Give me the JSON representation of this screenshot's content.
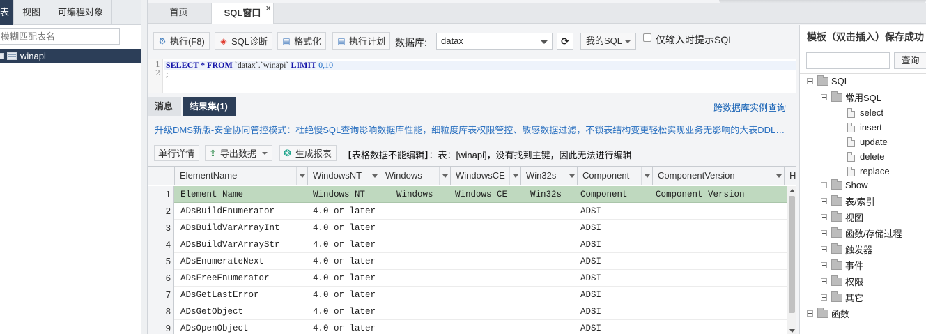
{
  "left_panel": {
    "tabs": [
      "表",
      "视图",
      "可编程对象"
    ],
    "search_placeholder": "模糊匹配表名",
    "tree_items": [
      {
        "label": "winapi"
      }
    ]
  },
  "main_tabs": {
    "home": "首页",
    "sql": "SQL窗口",
    "close": "×"
  },
  "toolbar": {
    "execute": "执行(F8)",
    "diagnose": "SQL诊断",
    "format": "格式化",
    "plan": "执行计划",
    "db_label": "数据库:",
    "db_value": "datax",
    "refresh_icon": "refresh-icon",
    "my_sql": "我的SQL",
    "hint_checkbox": "仅输入时提示SQL"
  },
  "editor": {
    "line_numbers": [
      "1",
      "2"
    ],
    "line1": {
      "kw1": "SELECT",
      "star": " * ",
      "kw2": "FROM",
      "table": " `datax`.`winapi` ",
      "kw3": "LIMIT",
      "nums": " 0,10"
    },
    "line2": ";"
  },
  "result_tabs": {
    "messages": "消息",
    "results": "结果集(1)",
    "cross_db": "跨数据库实例查询"
  },
  "banner": "升级DMS新版-安全协同管控模式：杜绝慢SQL查询影响数据库性能，细粒度库表权限管控、敏感数据过滤，不锁表结构变更轻松实现业务无影响的大表DDL，轻松实现多...",
  "result_toolbar": {
    "row_detail": "单行详情",
    "export": "导出数据",
    "report": "生成报表",
    "note": "【表格数据不能编辑】：表：[winapi]，没有找到主键，因此无法进行编辑"
  },
  "grid": {
    "columns": [
      "ElementName",
      "WindowsNT",
      "Windows",
      "WindowsCE",
      "Win32s",
      "Component",
      "ComponentVersion",
      "H"
    ],
    "rows": [
      {
        "n": "1",
        "cells": [
          "Element Name",
          "Windows NT",
          "Windows",
          "Windows CE",
          "Win32s",
          "Component",
          "Component Version"
        ]
      },
      {
        "n": "2",
        "cells": [
          "ADsBuildEnumerator",
          "4.0 or later",
          "",
          "",
          "",
          "ADSI",
          ""
        ]
      },
      {
        "n": "3",
        "cells": [
          "ADsBuildVarArrayInt",
          "4.0 or later",
          "",
          "",
          "",
          "ADSI",
          ""
        ]
      },
      {
        "n": "4",
        "cells": [
          "ADsBuildVarArrayStr",
          "4.0 or later",
          "",
          "",
          "",
          "ADSI",
          ""
        ]
      },
      {
        "n": "5",
        "cells": [
          "ADsEnumerateNext",
          "4.0 or later",
          "",
          "",
          "",
          "ADSI",
          ""
        ]
      },
      {
        "n": "6",
        "cells": [
          "ADsFreeEnumerator",
          "4.0 or later",
          "",
          "",
          "",
          "ADSI",
          ""
        ]
      },
      {
        "n": "7",
        "cells": [
          "ADsGetLastError",
          "4.0 or later",
          "",
          "",
          "",
          "ADSI",
          ""
        ]
      },
      {
        "n": "8",
        "cells": [
          "ADsGetObject",
          "4.0 or later",
          "",
          "",
          "",
          "ADSI",
          ""
        ]
      },
      {
        "n": "9",
        "cells": [
          "ADsOpenObject",
          "4.0 or later",
          "",
          "",
          "",
          "ADSI",
          ""
        ]
      }
    ]
  },
  "template_panel": {
    "title": "模板（双击插入）保存成功",
    "search_button": "查询",
    "tree": {
      "root": "SQL",
      "common": "常用SQL",
      "common_items": [
        "select",
        "insert",
        "update",
        "delete",
        "replace"
      ],
      "groups": [
        "Show",
        "表/索引",
        "视图",
        "函数/存储过程",
        "触发器",
        "事件",
        "权限",
        "其它"
      ],
      "functions": "函数"
    }
  },
  "colors": {
    "dark_nav": "#2c3e58",
    "link": "#1a64b6",
    "first_row": "#bfd9bf",
    "banner": "#2a70c0"
  }
}
